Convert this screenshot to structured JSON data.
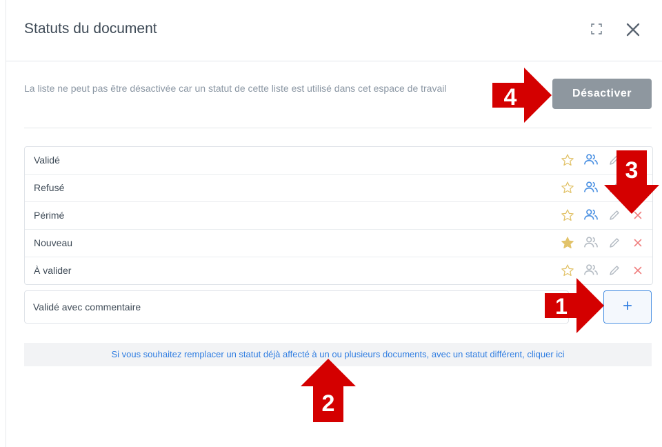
{
  "dialog": {
    "title": "Statuts du document",
    "warning": "La liste ne peut pas être désactivée car un statut de cette liste est utilisé dans cet espace de travail",
    "deactivate_label": "Désactiver",
    "new_status_value": "Validé avec commentaire",
    "add_label": "+",
    "replace_link": "Si vous souhaitez remplacer un statut déjà affecté à un ou plusieurs documents, avec un statut différent, cliquer ici"
  },
  "statuses": [
    {
      "label": "Validé",
      "default": false,
      "roles_active": true,
      "deletable": false
    },
    {
      "label": "Refusé",
      "default": false,
      "roles_active": true,
      "deletable": false
    },
    {
      "label": "Périmé",
      "default": false,
      "roles_active": true,
      "deletable": true
    },
    {
      "label": "Nouveau",
      "default": true,
      "roles_active": false,
      "deletable": true
    },
    {
      "label": "À valider",
      "default": false,
      "roles_active": false,
      "deletable": true
    }
  ],
  "callouts": {
    "c1": "1",
    "c2": "2",
    "c3": "3",
    "c4": "4"
  },
  "colors": {
    "star": "#e2c36a",
    "roles_active": "#4a90e2",
    "roles_inactive": "#b5bcc4",
    "edit": "#b5bcc4",
    "delete": "#f08080",
    "callout": "#d40000",
    "link": "#2f7de1"
  },
  "icons": {
    "expand": "expand-icon",
    "close": "close-icon",
    "star": "star-icon",
    "roles": "users-icon",
    "edit": "pencil-icon",
    "delete": "delete-icon"
  }
}
